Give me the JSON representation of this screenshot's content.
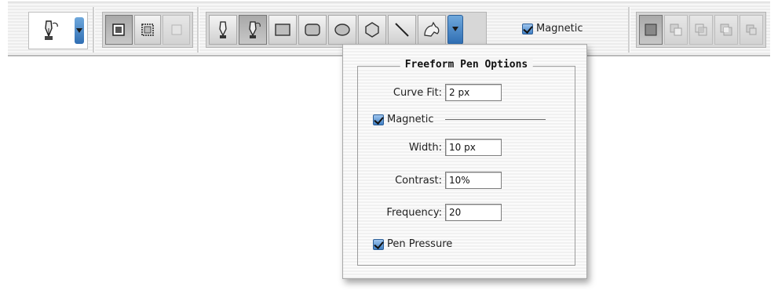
{
  "options_bar": {
    "tool_preset_icon": "freeform-pen-icon",
    "path_mode_buttons": [
      "shape-layers-icon",
      "paths-icon",
      "fill-pixels-icon"
    ],
    "drawing_tools": [
      "pen-icon",
      "freeform-pen-icon",
      "rectangle-icon",
      "rounded-rectangle-icon",
      "ellipse-icon",
      "polygon-icon",
      "line-icon",
      "custom-shape-icon"
    ],
    "magnetic_checkbox_label": "Magnetic",
    "magnetic_checked": true,
    "path_area_buttons": [
      "add-to-path-icon",
      "subtract-from-path-icon",
      "intersect-path-icon",
      "exclude-overlap-icon",
      "combine-icon"
    ],
    "accent_color": "#3f7fc4"
  },
  "popup": {
    "title": "Freeform Pen Options",
    "curve_fit": {
      "label": "Curve Fit:",
      "value": "2 px"
    },
    "magnetic": {
      "label": "Magnetic",
      "checked": true
    },
    "width": {
      "label": "Width:",
      "value": "10 px"
    },
    "contrast": {
      "label": "Contrast:",
      "value": "10%"
    },
    "frequency": {
      "label": "Frequency:",
      "value": "20"
    },
    "pen_pressure": {
      "label": "Pen Pressure",
      "checked": true
    }
  }
}
